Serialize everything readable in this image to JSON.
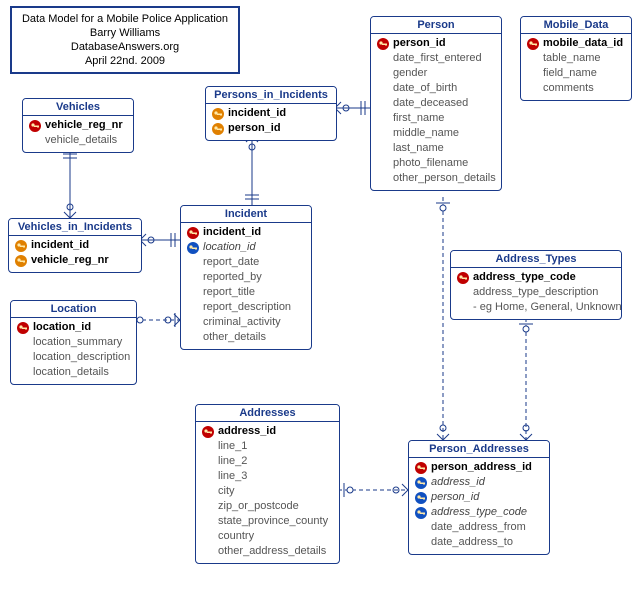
{
  "info": {
    "line1": "Data Model for a Mobile Police Application",
    "line2": "Barry Williams",
    "line3": "DatabaseAnswers.org",
    "line4": "April 22nd. 2009"
  },
  "entities": {
    "vehicles": {
      "title": "Vehicles",
      "attrs": [
        {
          "name": "vehicle_reg_nr",
          "key": "pk"
        },
        {
          "name": "vehicle_details",
          "key": ""
        }
      ]
    },
    "vehicles_in_incidents": {
      "title": "Vehicles_in_Incidents",
      "attrs": [
        {
          "name": "incident_id",
          "key": "pf"
        },
        {
          "name": "vehicle_reg_nr",
          "key": "pf"
        }
      ]
    },
    "location": {
      "title": "Location",
      "attrs": [
        {
          "name": "location_id",
          "key": "pk"
        },
        {
          "name": "location_summary",
          "key": ""
        },
        {
          "name": "location_description",
          "key": ""
        },
        {
          "name": "location_details",
          "key": ""
        }
      ]
    },
    "persons_in_incidents": {
      "title": "Persons_in_Incidents",
      "attrs": [
        {
          "name": "incident_id",
          "key": "pf"
        },
        {
          "name": "person_id",
          "key": "pf"
        }
      ]
    },
    "incident": {
      "title": "Incident",
      "attrs": [
        {
          "name": "incident_id",
          "key": "pk"
        },
        {
          "name": "location_id",
          "key": "fk"
        },
        {
          "name": "report_date",
          "key": ""
        },
        {
          "name": "reported_by",
          "key": ""
        },
        {
          "name": "report_title",
          "key": ""
        },
        {
          "name": "report_description",
          "key": ""
        },
        {
          "name": "criminal_activity",
          "key": ""
        },
        {
          "name": "other_details",
          "key": ""
        }
      ]
    },
    "person": {
      "title": "Person",
      "attrs": [
        {
          "name": "person_id",
          "key": "pk"
        },
        {
          "name": "date_first_entered",
          "key": ""
        },
        {
          "name": "gender",
          "key": ""
        },
        {
          "name": "date_of_birth",
          "key": ""
        },
        {
          "name": "date_deceased",
          "key": ""
        },
        {
          "name": "first_name",
          "key": ""
        },
        {
          "name": "middle_name",
          "key": ""
        },
        {
          "name": "last_name",
          "key": ""
        },
        {
          "name": "photo_filename",
          "key": ""
        },
        {
          "name": "other_person_details",
          "key": ""
        }
      ]
    },
    "mobile_data": {
      "title": "Mobile_Data",
      "attrs": [
        {
          "name": "mobile_data_id",
          "key": "pk"
        },
        {
          "name": "table_name",
          "key": ""
        },
        {
          "name": "field_name",
          "key": ""
        },
        {
          "name": "comments",
          "key": ""
        }
      ]
    },
    "address_types": {
      "title": "Address_Types",
      "attrs": [
        {
          "name": "address_type_code",
          "key": "pk"
        },
        {
          "name": "address_type_description",
          "key": ""
        },
        {
          "name": "- eg Home, General, Unknown",
          "key": ""
        }
      ]
    },
    "addresses": {
      "title": "Addresses",
      "attrs": [
        {
          "name": "address_id",
          "key": "pk"
        },
        {
          "name": "line_1",
          "key": ""
        },
        {
          "name": "line_2",
          "key": ""
        },
        {
          "name": "line_3",
          "key": ""
        },
        {
          "name": "city",
          "key": ""
        },
        {
          "name": "zip_or_postcode",
          "key": ""
        },
        {
          "name": "state_province_county",
          "key": ""
        },
        {
          "name": "country",
          "key": ""
        },
        {
          "name": "other_address_details",
          "key": ""
        }
      ]
    },
    "person_addresses": {
      "title": "Person_Addresses",
      "attrs": [
        {
          "name": "person_address_id",
          "key": "pk"
        },
        {
          "name": "address_id",
          "key": "fk"
        },
        {
          "name": "person_id",
          "key": "fk"
        },
        {
          "name": "address_type_code",
          "key": "fk"
        },
        {
          "name": "date_address_from",
          "key": ""
        },
        {
          "name": "date_address_to",
          "key": ""
        }
      ]
    }
  },
  "relationships": [
    {
      "from": "Vehicles",
      "to": "Vehicles_in_Incidents",
      "type": "identifying",
      "card": "one-to-many"
    },
    {
      "from": "Incident",
      "to": "Vehicles_in_Incidents",
      "type": "identifying",
      "card": "one-to-many"
    },
    {
      "from": "Incident",
      "to": "Persons_in_Incidents",
      "type": "identifying",
      "card": "one-to-many"
    },
    {
      "from": "Person",
      "to": "Persons_in_Incidents",
      "type": "identifying",
      "card": "one-to-many"
    },
    {
      "from": "Location",
      "to": "Incident",
      "type": "non-identifying",
      "card": "one-to-many"
    },
    {
      "from": "Person",
      "to": "Person_Addresses",
      "type": "non-identifying",
      "card": "one-to-many"
    },
    {
      "from": "Address_Types",
      "to": "Person_Addresses",
      "type": "non-identifying",
      "card": "one-to-many"
    },
    {
      "from": "Addresses",
      "to": "Person_Addresses",
      "type": "non-identifying",
      "card": "one-to-many"
    }
  ]
}
